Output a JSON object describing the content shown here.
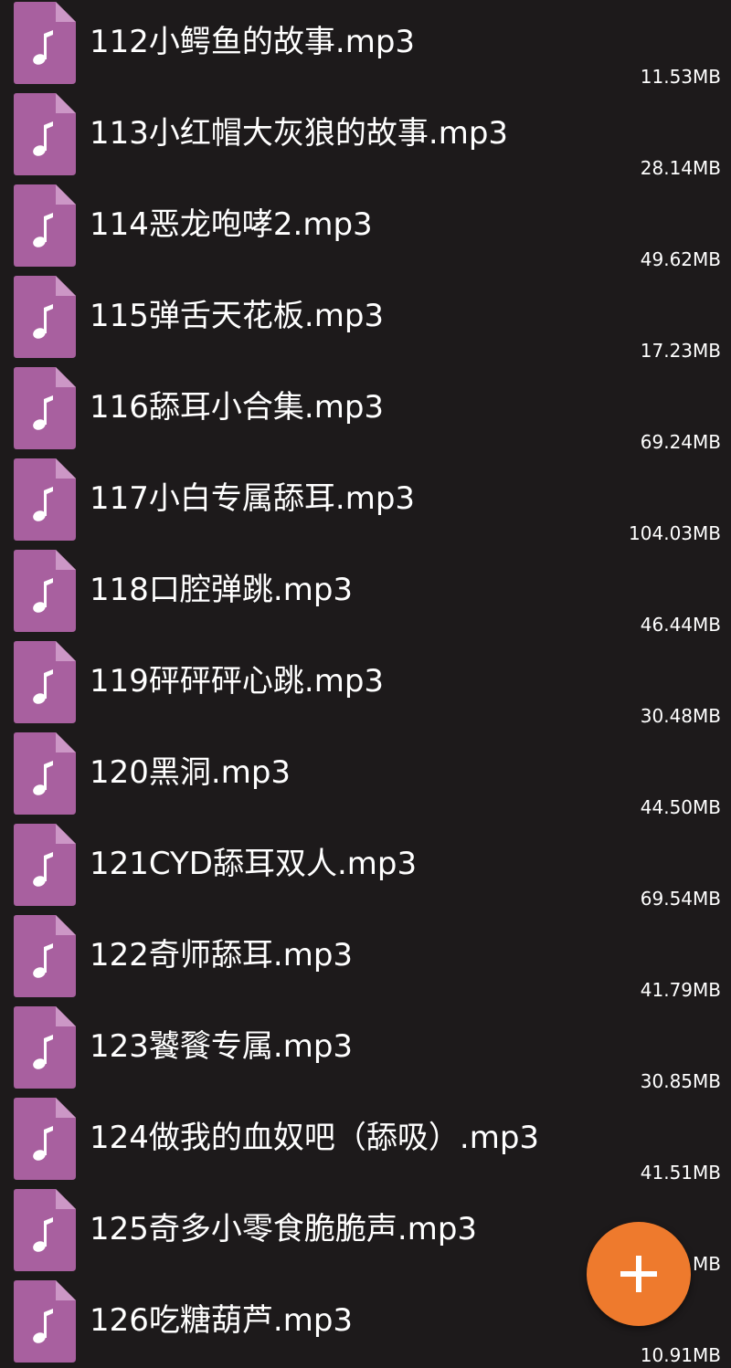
{
  "colors": {
    "background": "#1d1a1b",
    "icon_body": "#a8609f",
    "icon_fold": "#cc97c6",
    "fab": "#ee7a2d",
    "text": "#ffffff"
  },
  "files": [
    {
      "name": "112小鳄鱼的故事.mp3",
      "size": "11.53MB",
      "icon": "music-file-icon"
    },
    {
      "name": "113小红帽大灰狼的故事.mp3",
      "size": "28.14MB",
      "icon": "music-file-icon"
    },
    {
      "name": "114恶龙咆哮2.mp3",
      "size": "49.62MB",
      "icon": "music-file-icon"
    },
    {
      "name": "115弹舌天花板.mp3",
      "size": "17.23MB",
      "icon": "music-file-icon"
    },
    {
      "name": "116舔耳小合集.mp3",
      "size": "69.24MB",
      "icon": "music-file-icon"
    },
    {
      "name": "117小白专属舔耳.mp3",
      "size": "104.03MB",
      "icon": "music-file-icon"
    },
    {
      "name": "118口腔弹跳.mp3",
      "size": "46.44MB",
      "icon": "music-file-icon"
    },
    {
      "name": "119砰砰砰心跳.mp3",
      "size": "30.48MB",
      "icon": "music-file-icon"
    },
    {
      "name": "120黑洞.mp3",
      "size": "44.50MB",
      "icon": "music-file-icon"
    },
    {
      "name": "121CYD舔耳双人.mp3",
      "size": "69.54MB",
      "icon": "music-file-icon"
    },
    {
      "name": "122奇师舔耳.mp3",
      "size": "41.79MB",
      "icon": "music-file-icon"
    },
    {
      "name": "123饕餮专属.mp3",
      "size": "30.85MB",
      "icon": "music-file-icon"
    },
    {
      "name": "124做我的血奴吧（舔吸）.mp3",
      "size": "41.51MB",
      "icon": "music-file-icon"
    },
    {
      "name": "125奇多小零食脆脆声.mp3",
      "size": "MB",
      "icon": "music-file-icon"
    },
    {
      "name": "126吃糖葫芦.mp3",
      "size": "10.91MB",
      "icon": "music-file-icon"
    }
  ],
  "fab": {
    "icon": "plus-icon"
  }
}
